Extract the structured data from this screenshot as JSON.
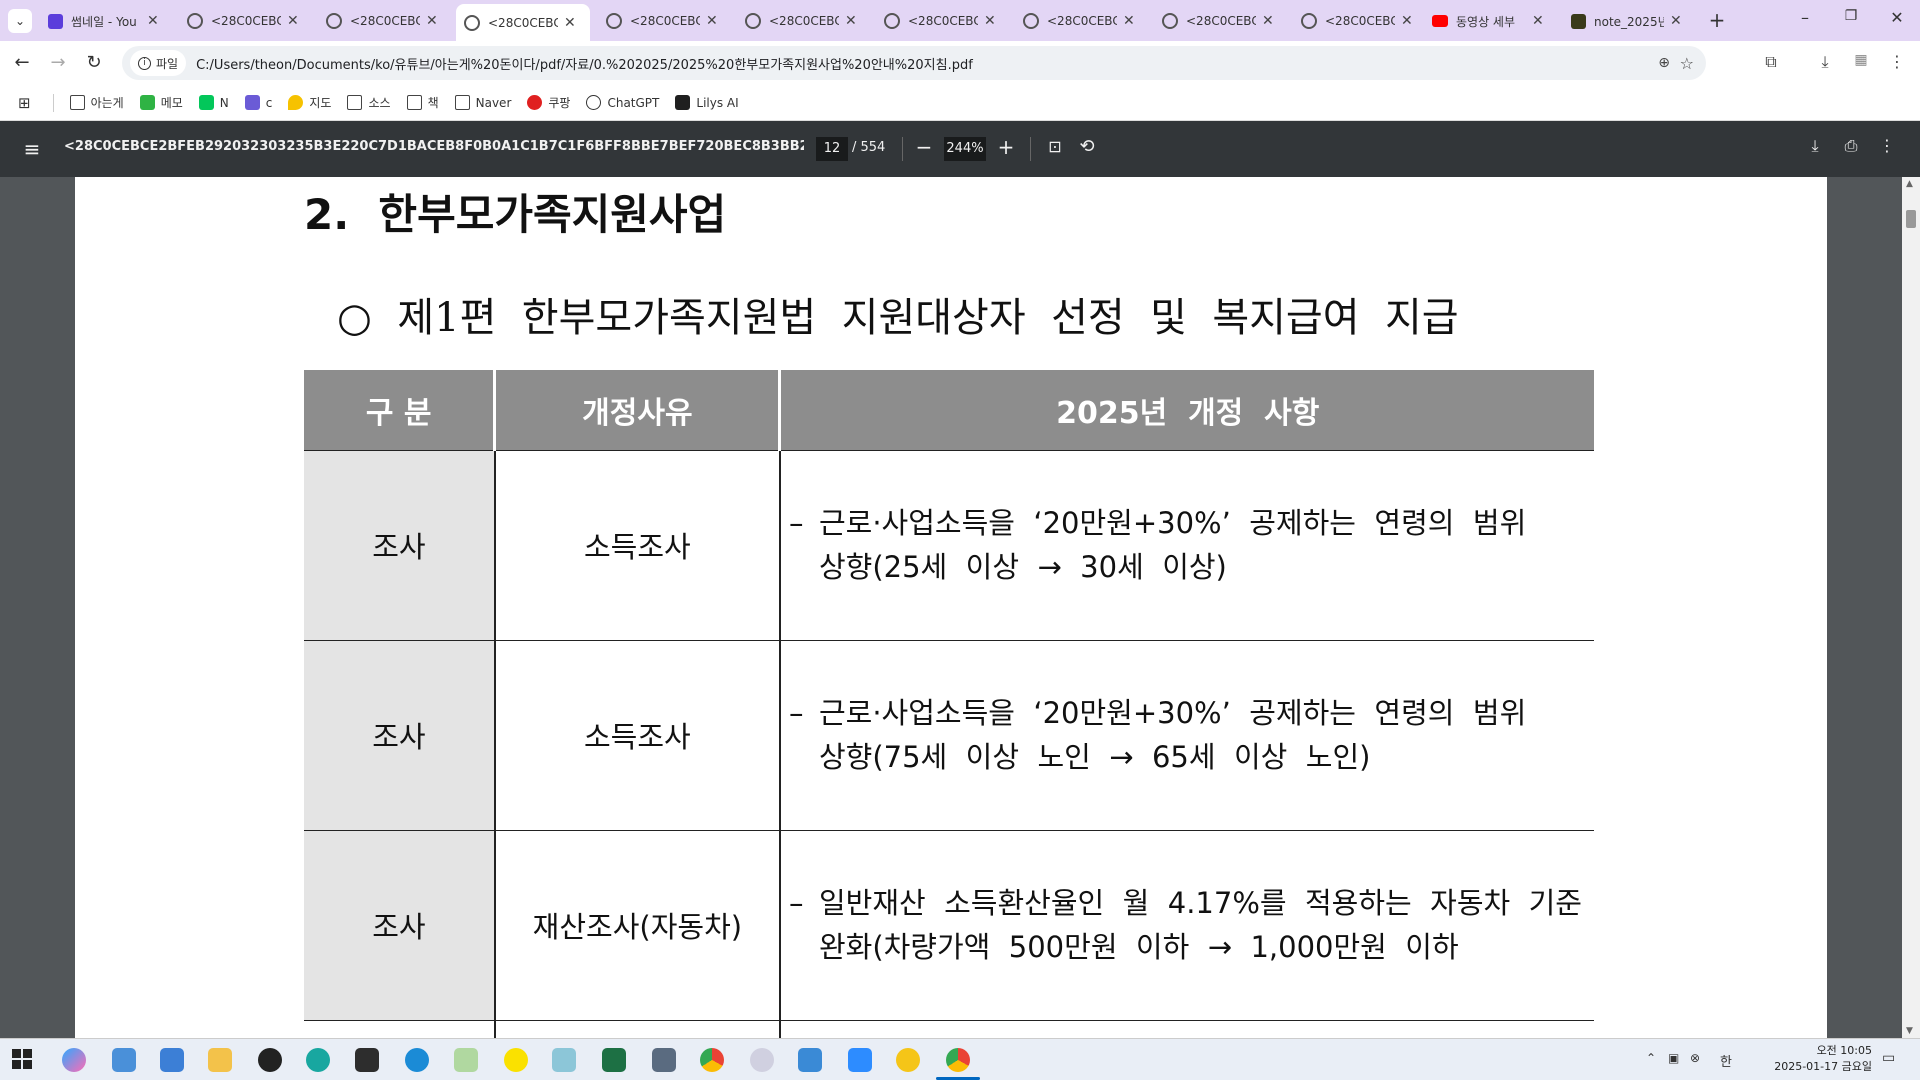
{
  "browser": {
    "tabs": [
      {
        "title": "썸네일 - You",
        "active": false,
        "icon": "youtube-studio-icon"
      },
      {
        "title": "<28C0CEBCE",
        "active": false,
        "icon": "globe-icon"
      },
      {
        "title": "<28C0CEBCE",
        "active": false,
        "icon": "globe-icon"
      },
      {
        "title": "<28C0CEBCE",
        "active": true,
        "icon": "globe-icon"
      },
      {
        "title": "<28C0CEBCE",
        "active": false,
        "icon": "globe-icon"
      },
      {
        "title": "<28C0CEBCE",
        "active": false,
        "icon": "globe-icon"
      },
      {
        "title": "<28C0CEBCE",
        "active": false,
        "icon": "globe-icon"
      },
      {
        "title": "<28C0CEBCE",
        "active": false,
        "icon": "globe-icon"
      },
      {
        "title": "<28C0CEBCE",
        "active": false,
        "icon": "globe-icon"
      },
      {
        "title": "<28C0CEBCE",
        "active": false,
        "icon": "globe-icon"
      },
      {
        "title": "동영상 세부",
        "active": false,
        "icon": "youtube-icon"
      },
      {
        "title": "note_2025년",
        "active": false,
        "icon": "note-icon"
      }
    ],
    "address": {
      "scheme_label": "파일",
      "url": "C:/Users/theon/Documents/ko/유튜브/아는게%20돈이다/pdf/자료/0.%202025/2025%20한부모가족지원사업%20안내%20지침.pdf"
    },
    "bookmarks": [
      {
        "label": "아는게",
        "icon": "folder-icon"
      },
      {
        "label": "메모",
        "icon": "memo-icon"
      },
      {
        "label": "N",
        "icon": "naver-icon"
      },
      {
        "label": "c",
        "icon": "calendar-icon"
      },
      {
        "label": "지도",
        "icon": "map-icon"
      },
      {
        "label": "소스",
        "icon": "folder-icon"
      },
      {
        "label": "책",
        "icon": "folder-icon"
      },
      {
        "label": "Naver",
        "icon": "folder-icon"
      },
      {
        "label": "쿠팡",
        "icon": "coupang-icon"
      },
      {
        "label": "ChatGPT",
        "icon": "chatgpt-icon"
      },
      {
        "label": "Lilys AI",
        "icon": "lilys-icon"
      }
    ]
  },
  "pdf_toolbar": {
    "title": "<28C0CEBCE2BFEB292032303235B3E220C7D1BACEB8F0B0A1C1B7C1F6BFF8BBE7BEF720BEC8B3BB20C1F6C4A720B...",
    "current_page": "12",
    "total_pages": "/ 554",
    "zoom": "244%"
  },
  "document": {
    "section_title": "2.  한부모가족지원사업",
    "subsection_title": "○  제1편  한부모가족지원법  지원대상자  선정  및  복지급여  지급",
    "table": {
      "headers": [
        "구 분",
        "개정사유",
        "2025년  개정  사항"
      ],
      "rows": [
        {
          "category": "조사",
          "reason": "소득조사",
          "change_line1": "근로·사업소득을  ‘20만원+30%’  공제하는  연령의  범위",
          "change_line2": "상향(25세  이상  →  30세  이상)"
        },
        {
          "category": "조사",
          "reason": "소득조사",
          "change_line1": "근로·사업소득을  ‘20만원+30%’  공제하는  연령의  범위",
          "change_line2": "상향(75세  이상  노인  →  65세  이상  노인)"
        },
        {
          "category": "조사",
          "reason": "재산조사(자동차)",
          "change_line1": "일반재산  소득환산율인  월  4.17%를  적용하는  자동차  기준",
          "change_line2": "완화(차량가액  500만원  이하  →  1,000만원  이하"
        }
      ],
      "dash": "–"
    }
  },
  "taskbar": {
    "time": "오전 10:05",
    "date": "2025-01-17 금요일",
    "ime": "한"
  },
  "colors": {
    "tabbar_bg": "#e3d6f5",
    "pdf_toolbar_bg": "#323639",
    "header_cell_bg": "#8d8d8d",
    "category_cell_bg": "#e4e4e4"
  }
}
